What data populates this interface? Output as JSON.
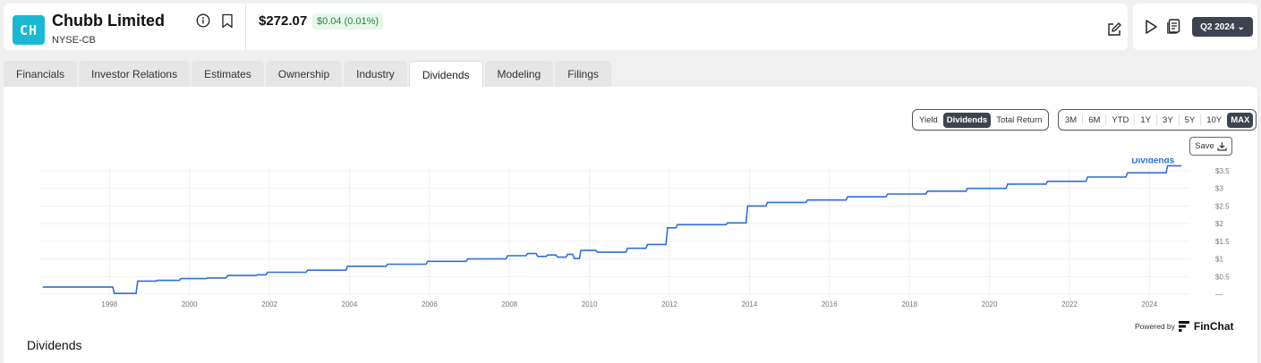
{
  "header": {
    "logo_text": "CH",
    "company_name": "Chubb Limited",
    "ticker": "NYSE-CB",
    "price": "$272.07",
    "change": "$0.04 (0.01%)",
    "quarter_label": "Q2 2024",
    "colors": {
      "logo": "#19b9d4",
      "change_positive": "#1f8a3b",
      "dark_button": "#3d4450"
    }
  },
  "tabs": [
    {
      "label": "Financials",
      "active": false
    },
    {
      "label": "Investor Relations",
      "active": false
    },
    {
      "label": "Estimates",
      "active": false
    },
    {
      "label": "Ownership",
      "active": false
    },
    {
      "label": "Industry",
      "active": false
    },
    {
      "label": "Dividends",
      "active": true
    },
    {
      "label": "Modeling",
      "active": false
    },
    {
      "label": "Filings",
      "active": false
    }
  ],
  "metric_toggle": [
    {
      "label": "Yield",
      "active": false
    },
    {
      "label": "Dividends",
      "active": true
    },
    {
      "label": "Total Return",
      "active": false
    }
  ],
  "range_toggle": [
    {
      "label": "3M",
      "active": false
    },
    {
      "label": "6M",
      "active": false
    },
    {
      "label": "YTD",
      "active": false
    },
    {
      "label": "1Y",
      "active": false
    },
    {
      "label": "3Y",
      "active": false
    },
    {
      "label": "5Y",
      "active": false
    },
    {
      "label": "10Y",
      "active": false
    },
    {
      "label": "MAX",
      "active": true
    }
  ],
  "save_label": "Save",
  "powered_by": "Powered by",
  "brand": "FinChat",
  "section_title": "Dividends",
  "chart_data": {
    "type": "line",
    "x_axis": "date",
    "xlim": [
      "1996-04-01",
      "2024-12-31"
    ],
    "ylim": [
      0,
      3.6
    ],
    "x_ticks": [
      "1998",
      "2000",
      "2002",
      "2004",
      "2006",
      "2008",
      "2010",
      "2012",
      "2014",
      "2016",
      "2018",
      "2020",
      "2022",
      "2024"
    ],
    "y_ticks": [
      "$3.5",
      "$3",
      "$2.5",
      "$2",
      "$1.5",
      "$1",
      "$0.5",
      "—"
    ],
    "grid": true,
    "series": [
      {
        "name": "Dividends",
        "color": "#2f6fd6",
        "points": [
          {
            "x": "1996-05-01",
            "y": 0.2
          },
          {
            "x": "1998-02-01",
            "y": 0.2
          },
          {
            "x": "1998-02-15",
            "y": 0.02
          },
          {
            "x": "1998-09-01",
            "y": 0.02
          },
          {
            "x": "1998-09-15",
            "y": 0.37
          },
          {
            "x": "1999-03-01",
            "y": 0.37
          },
          {
            "x": "1999-03-15",
            "y": 0.39
          },
          {
            "x": "1999-10-01",
            "y": 0.39
          },
          {
            "x": "1999-10-15",
            "y": 0.44
          },
          {
            "x": "2000-06-01",
            "y": 0.44
          },
          {
            "x": "2000-06-15",
            "y": 0.46
          },
          {
            "x": "2000-12-01",
            "y": 0.46
          },
          {
            "x": "2000-12-15",
            "y": 0.53
          },
          {
            "x": "2001-09-01",
            "y": 0.53
          },
          {
            "x": "2001-09-15",
            "y": 0.55
          },
          {
            "x": "2001-12-01",
            "y": 0.55
          },
          {
            "x": "2001-12-15",
            "y": 0.62
          },
          {
            "x": "2002-12-01",
            "y": 0.62
          },
          {
            "x": "2002-12-15",
            "y": 0.68
          },
          {
            "x": "2003-12-01",
            "y": 0.68
          },
          {
            "x": "2003-12-15",
            "y": 0.79
          },
          {
            "x": "2004-12-01",
            "y": 0.79
          },
          {
            "x": "2004-12-15",
            "y": 0.85
          },
          {
            "x": "2005-12-01",
            "y": 0.85
          },
          {
            "x": "2005-12-15",
            "y": 0.93
          },
          {
            "x": "2006-12-01",
            "y": 0.93
          },
          {
            "x": "2006-12-15",
            "y": 1.0
          },
          {
            "x": "2007-12-01",
            "y": 1.0
          },
          {
            "x": "2007-12-15",
            "y": 1.09
          },
          {
            "x": "2008-06-01",
            "y": 1.09
          },
          {
            "x": "2008-06-15",
            "y": 1.15
          },
          {
            "x": "2008-09-01",
            "y": 1.15
          },
          {
            "x": "2008-09-15",
            "y": 1.07
          },
          {
            "x": "2008-12-01",
            "y": 1.07
          },
          {
            "x": "2008-12-15",
            "y": 1.11
          },
          {
            "x": "2009-03-01",
            "y": 1.11
          },
          {
            "x": "2009-03-15",
            "y": 1.05
          },
          {
            "x": "2009-06-01",
            "y": 1.05
          },
          {
            "x": "2009-06-15",
            "y": 1.13
          },
          {
            "x": "2009-08-01",
            "y": 1.13
          },
          {
            "x": "2009-08-15",
            "y": 1.01
          },
          {
            "x": "2009-10-01",
            "y": 1.01
          },
          {
            "x": "2009-10-15",
            "y": 1.24
          },
          {
            "x": "2010-03-01",
            "y": 1.24
          },
          {
            "x": "2010-03-15",
            "y": 1.19
          },
          {
            "x": "2010-12-01",
            "y": 1.19
          },
          {
            "x": "2010-12-15",
            "y": 1.3
          },
          {
            "x": "2011-06-01",
            "y": 1.3
          },
          {
            "x": "2011-06-15",
            "y": 1.41
          },
          {
            "x": "2011-12-01",
            "y": 1.41
          },
          {
            "x": "2011-12-15",
            "y": 1.88
          },
          {
            "x": "2012-03-01",
            "y": 1.88
          },
          {
            "x": "2012-03-15",
            "y": 1.97
          },
          {
            "x": "2013-06-01",
            "y": 1.97
          },
          {
            "x": "2013-06-15",
            "y": 2.02
          },
          {
            "x": "2013-12-01",
            "y": 2.02
          },
          {
            "x": "2013-12-15",
            "y": 2.5
          },
          {
            "x": "2014-06-01",
            "y": 2.5
          },
          {
            "x": "2014-06-15",
            "y": 2.6
          },
          {
            "x": "2015-06-01",
            "y": 2.6
          },
          {
            "x": "2015-06-15",
            "y": 2.67
          },
          {
            "x": "2016-06-01",
            "y": 2.67
          },
          {
            "x": "2016-06-15",
            "y": 2.76
          },
          {
            "x": "2017-06-01",
            "y": 2.76
          },
          {
            "x": "2017-06-15",
            "y": 2.84
          },
          {
            "x": "2018-06-01",
            "y": 2.84
          },
          {
            "x": "2018-06-15",
            "y": 2.92
          },
          {
            "x": "2019-06-01",
            "y": 2.92
          },
          {
            "x": "2019-06-15",
            "y": 3.0
          },
          {
            "x": "2020-06-01",
            "y": 3.0
          },
          {
            "x": "2020-06-15",
            "y": 3.12
          },
          {
            "x": "2021-06-01",
            "y": 3.12
          },
          {
            "x": "2021-06-15",
            "y": 3.2
          },
          {
            "x": "2022-06-01",
            "y": 3.2
          },
          {
            "x": "2022-06-15",
            "y": 3.32
          },
          {
            "x": "2023-06-01",
            "y": 3.32
          },
          {
            "x": "2023-06-15",
            "y": 3.44
          },
          {
            "x": "2024-06-01",
            "y": 3.44
          },
          {
            "x": "2024-06-15",
            "y": 3.64
          },
          {
            "x": "2024-10-20",
            "y": 3.64
          }
        ]
      }
    ]
  }
}
